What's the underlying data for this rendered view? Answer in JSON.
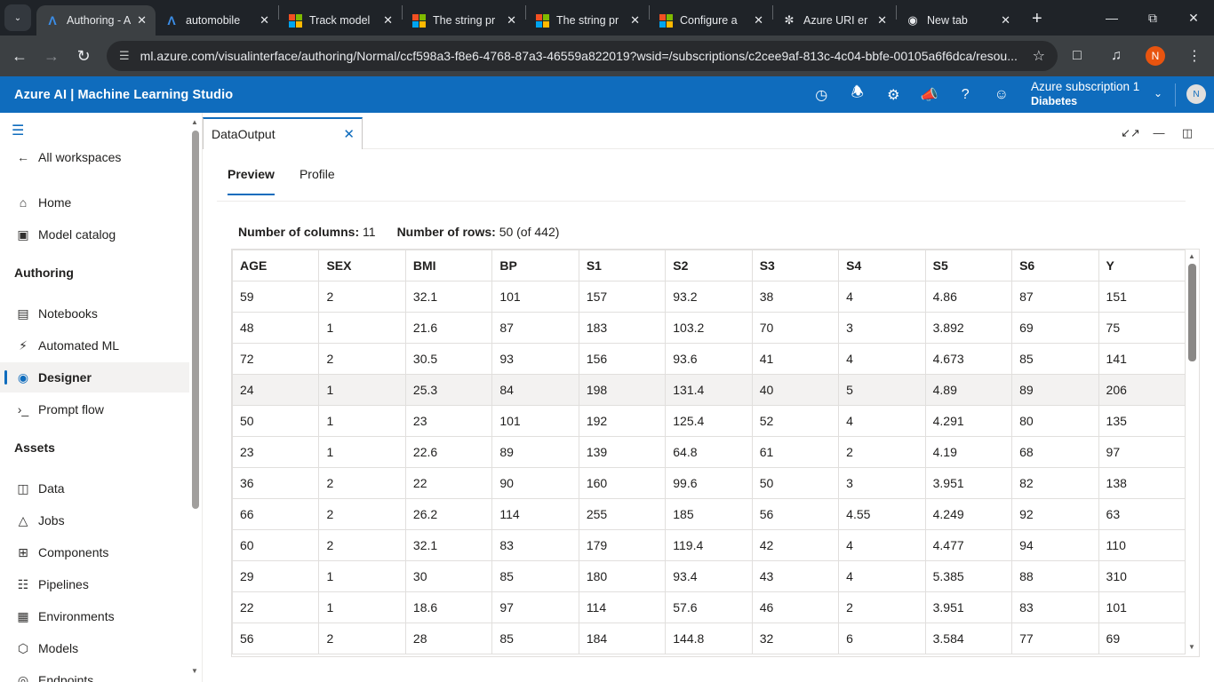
{
  "browser": {
    "tabs": [
      {
        "title": "Authoring - A",
        "favicon": "azure-ml-icon",
        "active": true
      },
      {
        "title": "automobile",
        "favicon": "azure-icon"
      },
      {
        "title": "Track model",
        "favicon": "microsoft-icon"
      },
      {
        "title": "The string pr",
        "favicon": "microsoft-icon"
      },
      {
        "title": "The string pr",
        "favicon": "microsoft-icon"
      },
      {
        "title": "Configure a",
        "favicon": "microsoft-icon"
      },
      {
        "title": "Azure URI er",
        "favicon": "openai-icon"
      },
      {
        "title": "New tab",
        "favicon": "chrome-icon"
      }
    ],
    "url": "ml.azure.com/visualinterface/authoring/Normal/ccf598a3-f8e6-4768-87a3-46559a822019?wsid=/subscriptions/c2cee9af-813c-4c04-bbfe-00105a6f6dca/resou...",
    "profile_initial": "N"
  },
  "header": {
    "brand": "Azure AI | Machine Learning Studio",
    "subscription": "Azure subscription 1",
    "workspace": "Diabetes",
    "avatar_initial": "N",
    "icons": [
      "history-icon",
      "bell-icon",
      "settings-icon",
      "feedback-icon",
      "help-icon",
      "smiley-icon"
    ]
  },
  "sidebar": {
    "back_label": "All workspaces",
    "top_items": [
      {
        "label": "Home",
        "icon": "home-icon"
      },
      {
        "label": "Model catalog",
        "icon": "catalog-icon"
      }
    ],
    "authoring_title": "Authoring",
    "authoring_items": [
      {
        "label": "Notebooks",
        "icon": "notebook-icon"
      },
      {
        "label": "Automated ML",
        "icon": "automl-icon"
      },
      {
        "label": "Designer",
        "icon": "designer-icon",
        "selected": true
      },
      {
        "label": "Prompt flow",
        "icon": "prompt-icon"
      }
    ],
    "assets_title": "Assets",
    "assets_items": [
      {
        "label": "Data",
        "icon": "data-icon"
      },
      {
        "label": "Jobs",
        "icon": "jobs-icon"
      },
      {
        "label": "Components",
        "icon": "components-icon"
      },
      {
        "label": "Pipelines",
        "icon": "pipelines-icon"
      },
      {
        "label": "Environments",
        "icon": "environments-icon"
      },
      {
        "label": "Models",
        "icon": "models-icon"
      },
      {
        "label": "Endpoints",
        "icon": "endpoints-icon"
      }
    ]
  },
  "panel": {
    "tab_title": "DataOutput",
    "subtabs": [
      "Preview",
      "Profile"
    ],
    "active_subtab": "Preview",
    "columns_label": "Number of columns:",
    "columns_value": "11",
    "rows_label": "Number of rows:",
    "rows_value": "50 (of 442)"
  },
  "table": {
    "headers": [
      "AGE",
      "SEX",
      "BMI",
      "BP",
      "S1",
      "S2",
      "S3",
      "S4",
      "S5",
      "S6",
      "Y"
    ],
    "rows": [
      [
        "59",
        "2",
        "32.1",
        "101",
        "157",
        "93.2",
        "38",
        "4",
        "4.86",
        "87",
        "151"
      ],
      [
        "48",
        "1",
        "21.6",
        "87",
        "183",
        "103.2",
        "70",
        "3",
        "3.892",
        "69",
        "75"
      ],
      [
        "72",
        "2",
        "30.5",
        "93",
        "156",
        "93.6",
        "41",
        "4",
        "4.673",
        "85",
        "141"
      ],
      [
        "24",
        "1",
        "25.3",
        "84",
        "198",
        "131.4",
        "40",
        "5",
        "4.89",
        "89",
        "206"
      ],
      [
        "50",
        "1",
        "23",
        "101",
        "192",
        "125.4",
        "52",
        "4",
        "4.291",
        "80",
        "135"
      ],
      [
        "23",
        "1",
        "22.6",
        "89",
        "139",
        "64.8",
        "61",
        "2",
        "4.19",
        "68",
        "97"
      ],
      [
        "36",
        "2",
        "22",
        "90",
        "160",
        "99.6",
        "50",
        "3",
        "3.951",
        "82",
        "138"
      ],
      [
        "66",
        "2",
        "26.2",
        "114",
        "255",
        "185",
        "56",
        "4.55",
        "4.249",
        "92",
        "63"
      ],
      [
        "60",
        "2",
        "32.1",
        "83",
        "179",
        "119.4",
        "42",
        "4",
        "4.477",
        "94",
        "110"
      ],
      [
        "29",
        "1",
        "30",
        "85",
        "180",
        "93.4",
        "43",
        "4",
        "5.385",
        "88",
        "310"
      ],
      [
        "22",
        "1",
        "18.6",
        "97",
        "114",
        "57.6",
        "46",
        "2",
        "3.951",
        "83",
        "101"
      ],
      [
        "56",
        "2",
        "28",
        "85",
        "184",
        "144.8",
        "32",
        "6",
        "3.584",
        "77",
        "69"
      ]
    ],
    "highlighted_row": 3
  },
  "colors": {
    "accent": "#0f6cbd",
    "chrome_dark": "#1f2328"
  }
}
